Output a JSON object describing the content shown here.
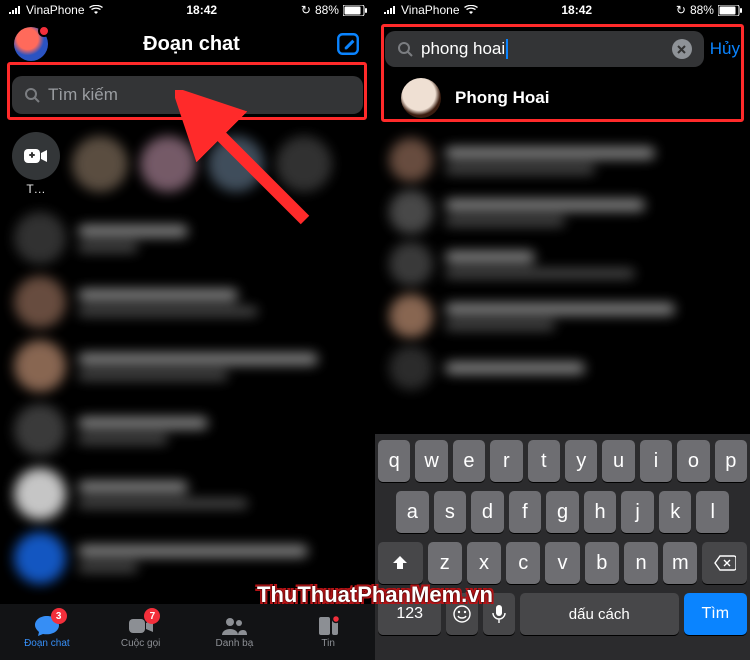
{
  "status": {
    "carrier": "VinaPhone",
    "time": "18:42",
    "battery_pct": "88%",
    "recharge_icon": "↻"
  },
  "left": {
    "header_title": "Đoạn chat",
    "search_placeholder": "Tìm kiếm",
    "create_label": "T…",
    "tabs": {
      "chats": {
        "label": "Đoạn chat",
        "badge": "3"
      },
      "calls": {
        "label": "Cuộc gọi",
        "badge": "7"
      },
      "people": {
        "label": "Danh bạ"
      },
      "news": {
        "label": "Tin"
      }
    }
  },
  "right": {
    "search_value": "phong hoai",
    "cancel": "Hủy",
    "result_name": "Phong Hoai"
  },
  "keyboard": {
    "row1": [
      "q",
      "w",
      "e",
      "r",
      "t",
      "y",
      "u",
      "i",
      "o",
      "p"
    ],
    "row2": [
      "a",
      "s",
      "d",
      "f",
      "g",
      "h",
      "j",
      "k",
      "l"
    ],
    "row3": [
      "z",
      "x",
      "c",
      "v",
      "b",
      "n",
      "m"
    ],
    "n123": "123",
    "space": "dấu cách",
    "search": "Tìm"
  },
  "watermark": "ThuThuatPhanMem.vn"
}
